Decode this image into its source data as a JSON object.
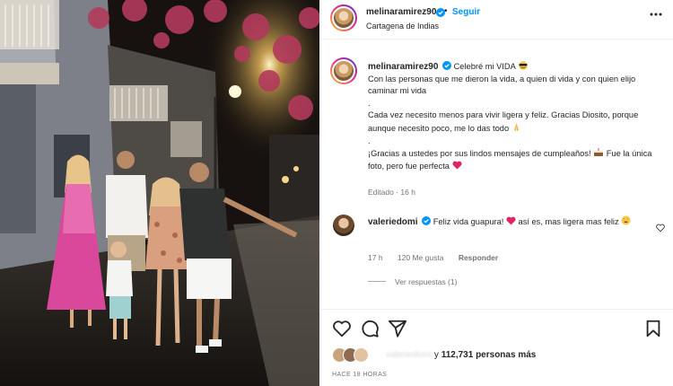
{
  "post": {
    "username": "melinaramirez90",
    "follow_label": "Seguir",
    "location": "Cartagena de Indias",
    "separator": "•"
  },
  "caption": {
    "username": "melinaramirez90",
    "line1": "Celebré mi VIDA",
    "line2": "Con las personas que me dieron la vida, a quien di vida y con quien elijo caminar mi vida",
    "line3": ".",
    "line4": "Cada vez necesito menos para vivir ligera y feliz. Gracias Diosito, porque aunque necesito poco, me lo das todo",
    "line5": ".",
    "line6a": "¡Gracias a ustedes por sus lindos mensajes de cumpleaños!",
    "line6b": "Fue la única foto, pero fue perfecta",
    "meta": "Editado · 16 h"
  },
  "comment": {
    "username": "valeriedomi",
    "text_a": "Feliz vida guapura!",
    "text_b": "así es, mas ligera mas feliz",
    "time": "17 h",
    "likes": "120 Me gusta",
    "reply_label": "Responder",
    "view_replies": "Ver respuestas (1)"
  },
  "actions": {
    "like_icon": "heart-icon",
    "comment_icon": "comment-icon",
    "share_icon": "send-icon",
    "save_icon": "bookmark-icon"
  },
  "likes": {
    "blurred_name": "valeriedomi",
    "connector": "y",
    "count": "112,731 personas más"
  },
  "timestamp": "HACE 18 HORAS",
  "colors": {
    "accent": "#0095f6",
    "verified": "#0095f6",
    "heart": "#ed4956",
    "muted": "#737373"
  }
}
